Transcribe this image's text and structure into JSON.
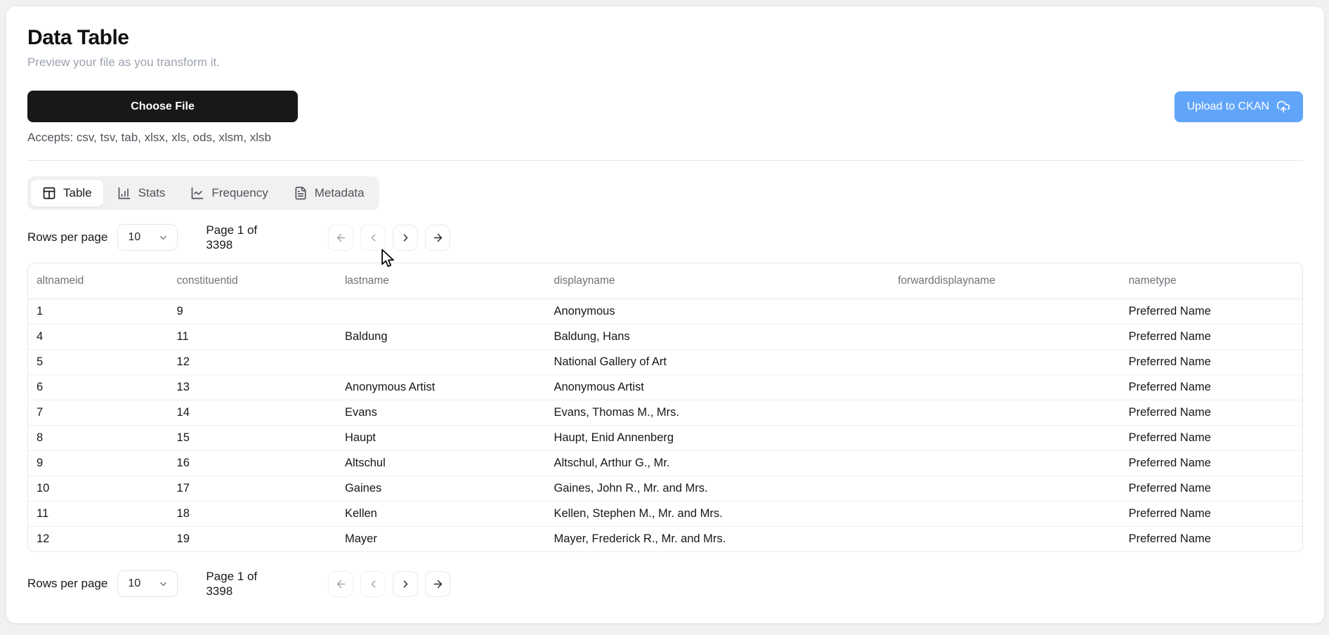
{
  "header": {
    "title": "Data Table",
    "subtitle": "Preview your file as you transform it."
  },
  "file_upload": {
    "choose_file_label": "Choose File",
    "accepts_text": "Accepts: csv, tsv, tab, xlsx, xls, ods, xlsm, xlsb",
    "upload_button_label": "Upload to CKAN",
    "upload_button_icon": "cloud-upload-icon"
  },
  "tabs": [
    {
      "label": "Table",
      "icon": "table-icon",
      "active": true
    },
    {
      "label": "Stats",
      "icon": "bar-chart-icon",
      "active": false
    },
    {
      "label": "Frequency",
      "icon": "line-chart-icon",
      "active": false
    },
    {
      "label": "Metadata",
      "icon": "file-text-icon",
      "active": false
    }
  ],
  "pagination": {
    "rows_per_page_label": "Rows per page",
    "rows_per_page_value": "10",
    "page_status": "Page 1 of 3398",
    "buttons": [
      {
        "name": "first-page",
        "icon": "arrow-left-icon",
        "enabled": false
      },
      {
        "name": "previous-page",
        "icon": "chevron-left-icon",
        "enabled": false
      },
      {
        "name": "next-page",
        "icon": "chevron-right-icon",
        "enabled": true
      },
      {
        "name": "last-page",
        "icon": "arrow-right-icon",
        "enabled": true
      }
    ]
  },
  "table": {
    "columns": [
      "altnameid",
      "constituentid",
      "lastname",
      "displayname",
      "forwarddisplayname",
      "nametype"
    ],
    "rows": [
      [
        "1",
        "9",
        "",
        "Anonymous",
        "",
        "Preferred Name"
      ],
      [
        "4",
        "11",
        "Baldung",
        "Baldung, Hans",
        "",
        "Preferred Name"
      ],
      [
        "5",
        "12",
        "",
        "National Gallery of Art",
        "",
        "Preferred Name"
      ],
      [
        "6",
        "13",
        "Anonymous Artist",
        "Anonymous Artist",
        "",
        "Preferred Name"
      ],
      [
        "7",
        "14",
        "Evans",
        "Evans, Thomas M., Mrs.",
        "",
        "Preferred Name"
      ],
      [
        "8",
        "15",
        "Haupt",
        "Haupt, Enid Annenberg",
        "",
        "Preferred Name"
      ],
      [
        "9",
        "16",
        "Altschul",
        "Altschul, Arthur G., Mr.",
        "",
        "Preferred Name"
      ],
      [
        "10",
        "17",
        "Gaines",
        "Gaines, John R., Mr. and Mrs.",
        "",
        "Preferred Name"
      ],
      [
        "11",
        "18",
        "Kellen",
        "Kellen, Stephen M., Mr. and Mrs.",
        "",
        "Preferred Name"
      ],
      [
        "12",
        "19",
        "Mayer",
        "Mayer, Frederick R., Mr. and Mrs.",
        "",
        "Preferred Name"
      ]
    ]
  },
  "colors": {
    "accent_blue": "#60a5fa",
    "button_black": "#18181b",
    "border": "#e5e7eb",
    "muted_text": "#71717a",
    "subtitle_text": "#9ca3af"
  }
}
